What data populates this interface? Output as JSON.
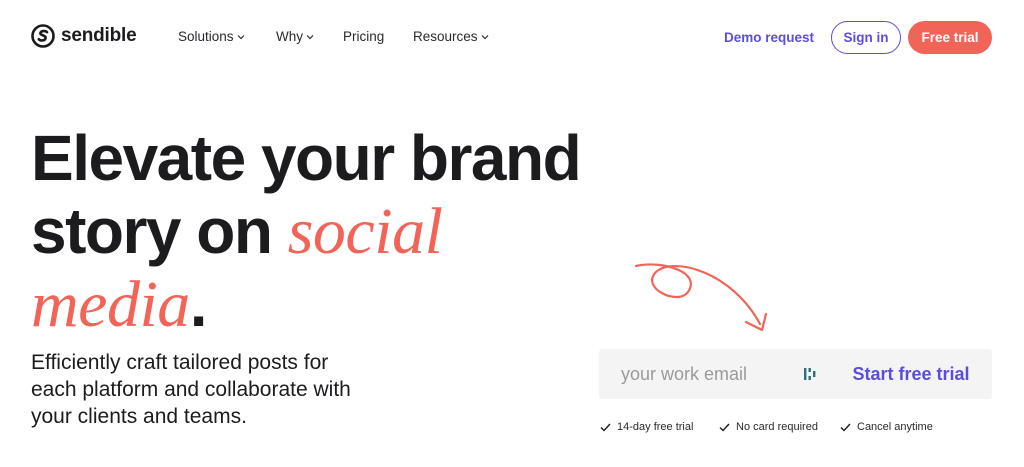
{
  "header": {
    "brand": "sendible",
    "nav": [
      {
        "label": "Solutions",
        "dropdown": true
      },
      {
        "label": "Why",
        "dropdown": true
      },
      {
        "label": "Pricing",
        "dropdown": false
      },
      {
        "label": "Resources",
        "dropdown": true
      }
    ],
    "demo_label": "Demo request",
    "signin_label": "Sign in",
    "trial_label": "Free trial"
  },
  "hero": {
    "title_line1": "Elevate your brand",
    "title_line2_prefix": "story on ",
    "title_accent_1": "social",
    "title_accent_2": "media",
    "title_suffix": ".",
    "subtitle": "Efficiently craft tailored posts for each platform and collaborate with your clients and teams."
  },
  "signup": {
    "email_placeholder": "your work email",
    "email_value": "",
    "cta_label": "Start free trial",
    "perks": [
      "14-day free trial",
      "No card required",
      "Cancel anytime"
    ]
  },
  "colors": {
    "accent_purple": "#5b4de0",
    "accent_coral": "#f26457",
    "text_dark": "#1c1c1f",
    "form_bg": "#f4f4f4"
  },
  "icons": {
    "logo": "sendible-logo-icon",
    "dropdown": "chevron-down-icon",
    "check": "check-icon",
    "arrow": "curly-arrow-icon",
    "form_extension": "password-manager-icon"
  }
}
